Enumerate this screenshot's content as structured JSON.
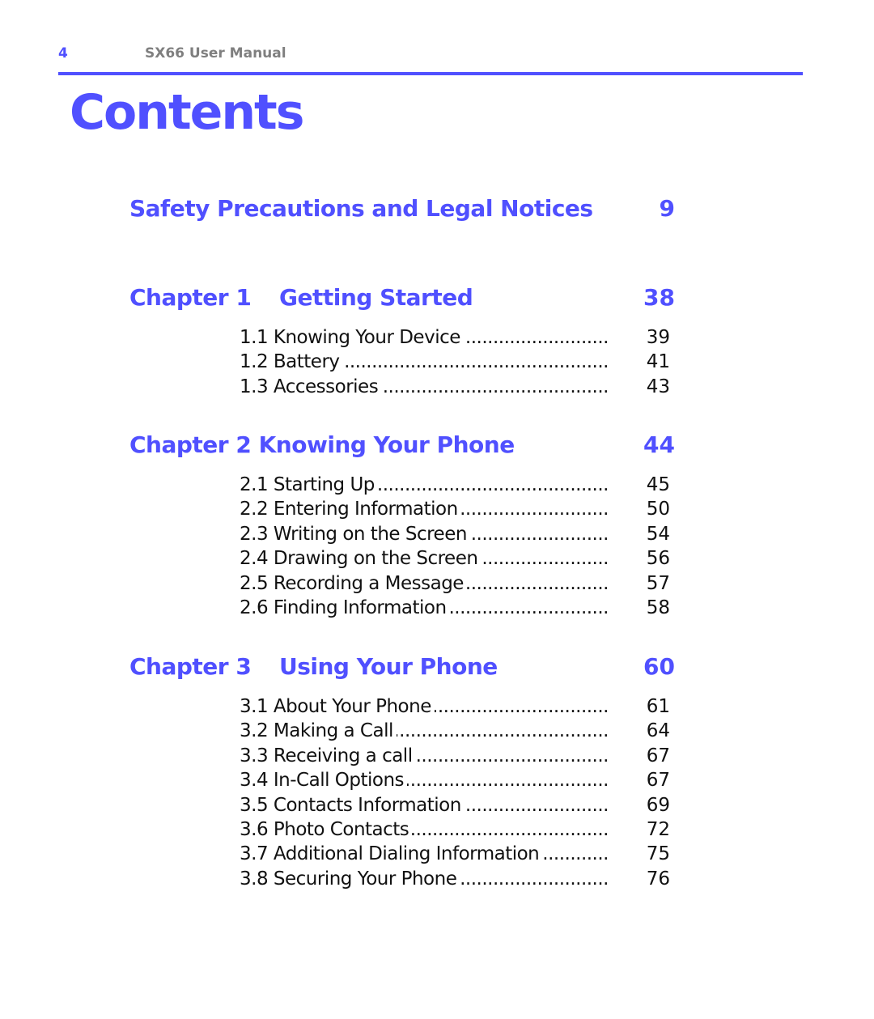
{
  "header": {
    "page_number": "4",
    "manual_title": "SX66 User Manual"
  },
  "title": "Contents",
  "accent_color": "#5050ff",
  "safety": {
    "label": "Safety Precautions and Legal Notices",
    "page": "9"
  },
  "chapters": [
    {
      "prefix": "Chapter 1",
      "name": "Getting Started",
      "page": "38",
      "items": [
        {
          "num": "1.1",
          "label": "Knowing Your Device",
          "page": "39"
        },
        {
          "num": "1.2",
          "label": "Battery",
          "page": "41"
        },
        {
          "num": "1.3",
          "label": "Accessories",
          "page": "43"
        }
      ]
    },
    {
      "prefix": "Chapter 2",
      "name": "Knowing Your Phone",
      "page": "44",
      "items": [
        {
          "num": "2.1",
          "label": "Starting Up",
          "page": "45"
        },
        {
          "num": "2.2",
          "label": "Entering Information",
          "page": "50"
        },
        {
          "num": "2.3",
          "label": "Writing on the Screen",
          "page": "54"
        },
        {
          "num": "2.4",
          "label": "Drawing on the Screen",
          "page": "56"
        },
        {
          "num": "2.5",
          "label": "Recording a Message",
          "page": "57"
        },
        {
          "num": "2.6",
          "label": "Finding Information",
          "page": "58"
        }
      ]
    },
    {
      "prefix": "Chapter 3",
      "name": "Using Your Phone",
      "page": "60",
      "items": [
        {
          "num": "3.1",
          "label": "About Your Phone",
          "page": "61"
        },
        {
          "num": "3.2",
          "label": "Making a Call",
          "page": "64"
        },
        {
          "num": "3.3",
          "label": "Receiving a call",
          "page": "67"
        },
        {
          "num": "3.4",
          "label": "In-Call Options",
          "page": "67"
        },
        {
          "num": "3.5",
          "label": "Contacts Information",
          "page": "69"
        },
        {
          "num": "3.6",
          "label": "Photo Contacts",
          "page": "72"
        },
        {
          "num": "3.7",
          "label": "Additional Dialing Information",
          "page": "75"
        },
        {
          "num": "3.8",
          "label": "Securing Your Phone",
          "page": "76"
        }
      ]
    }
  ]
}
